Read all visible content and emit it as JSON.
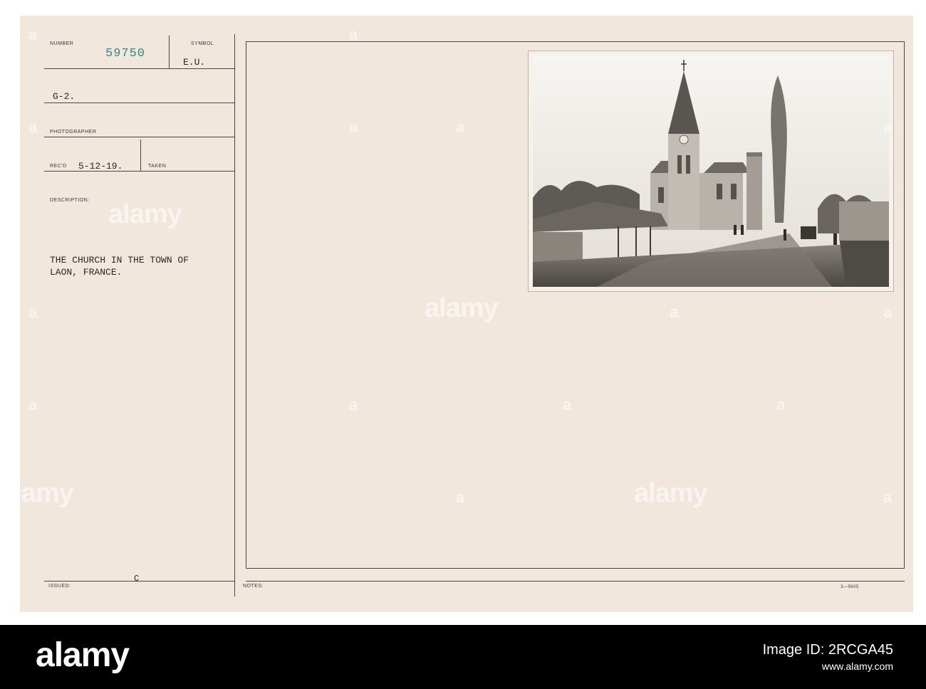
{
  "labels": {
    "number": "NUMBER",
    "symbol": "SYMBOL",
    "photographer": "PHOTOGRAPHER",
    "recd": "REC'D",
    "taken": "TAKEN",
    "description": "DESCRIPTION:",
    "issued": "ISSUED:",
    "notes": "NOTES:"
  },
  "values": {
    "number": "59750",
    "symbol": "E.U.",
    "unit": "G-2.",
    "recd_date": "5-12-19.",
    "description_line1": "THE CHURCH IN THE TOWN OF",
    "description_line2": "LAON, FRANCE.",
    "issued_mark": "C",
    "form_code": "3—5605"
  },
  "watermark": {
    "word": "alamy",
    "letter": "a"
  },
  "footer": {
    "logo": "alamy",
    "image_id": "Image ID: 2RCGA45",
    "site": "www.alamy.com"
  },
  "colors": {
    "card": "#f2e7dd",
    "number_ink": "#2f8a88",
    "band": "#000000"
  }
}
